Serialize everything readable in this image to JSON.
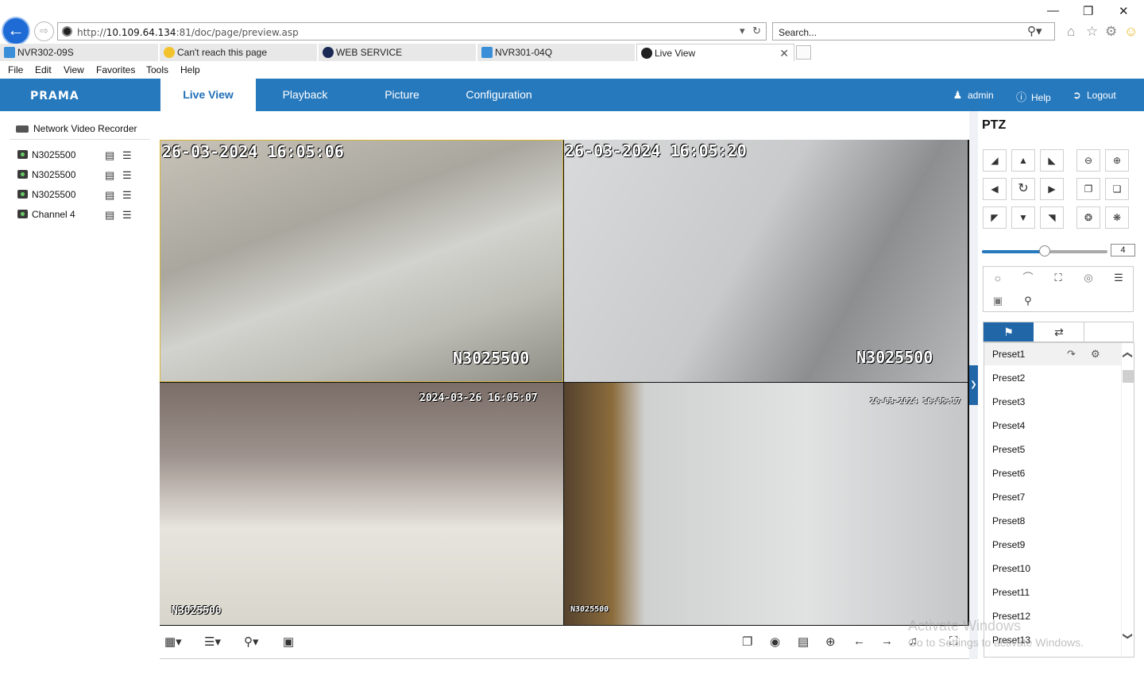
{
  "browser": {
    "url_prefix": "http://",
    "url_host": "10.109.64.134",
    "url_rest": ":81/doc/page/preview.asp",
    "search_placeholder": "Search...",
    "tabs": [
      {
        "label": "NVR302-09S",
        "icon": "nvr-icon"
      },
      {
        "label": "Can't reach this page",
        "icon": "ie-icon"
      },
      {
        "label": "WEB SERVICE",
        "icon": "globe-icon"
      },
      {
        "label": "NVR301-04Q",
        "icon": "nvr-icon"
      },
      {
        "label": "Live View",
        "icon": "camera-icon",
        "active": true
      }
    ],
    "menu": [
      "File",
      "Edit",
      "View",
      "Favorites",
      "Tools",
      "Help"
    ]
  },
  "app": {
    "logo": "PRAMA",
    "nav": [
      "Live View",
      "Playback",
      "Picture",
      "Configuration"
    ],
    "active_nav": "Live View",
    "user": "admin",
    "help": "Help",
    "logout": "Logout"
  },
  "tree": {
    "root": "Network Video Recorder",
    "channels": [
      "N3025500",
      "N3025500",
      "N3025500",
      "Channel 4"
    ]
  },
  "video": {
    "cells": [
      {
        "timestamp": "26-03-2024 16:05:06",
        "name": "N3025500"
      },
      {
        "timestamp": "26-03-2024 16:05:20",
        "name": "N3025500"
      },
      {
        "timestamp": "2024-03-26 16:05:07",
        "name": "N3025500"
      },
      {
        "timestamp": "26-03-2024 16:05:17",
        "name": "N3025500"
      }
    ]
  },
  "ptz": {
    "title": "PTZ",
    "speed": "4",
    "speed_level": 0.5,
    "presets": [
      "Preset1",
      "Preset2",
      "Preset3",
      "Preset4",
      "Preset5",
      "Preset6",
      "Preset7",
      "Preset8",
      "Preset9",
      "Preset10",
      "Preset11",
      "Preset12",
      "Preset13"
    ]
  },
  "overlay": {
    "line1": "Activate Windows",
    "line2": "Go to Settings to activate Windows."
  },
  "colors": {
    "brand_blue": "#2779bd",
    "selected_border": "#d6b53a"
  }
}
